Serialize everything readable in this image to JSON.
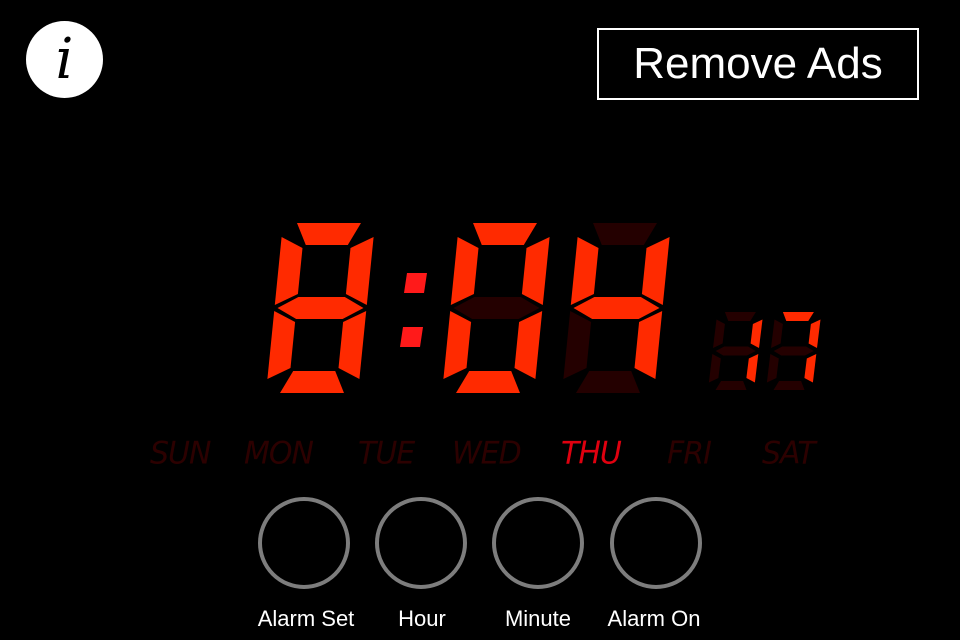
{
  "header": {
    "info_icon_glyph": "i",
    "remove_ads_label": "Remove Ads"
  },
  "clock": {
    "hour": "8",
    "minute": "04",
    "seconds": "17",
    "colon": ":",
    "colors": {
      "segment_on": "#ff2a00",
      "segment_off": "#240000",
      "colon": "#ff1a1a"
    }
  },
  "days": {
    "items": [
      "SUN",
      "MON",
      "TUE",
      "WED",
      "THU",
      "FRI",
      "SAT"
    ],
    "active": "THU",
    "colors": {
      "active": "#e0000f",
      "inactive": "#2c0000"
    }
  },
  "controls": [
    {
      "label": "Alarm Set"
    },
    {
      "label": "Hour"
    },
    {
      "label": "Minute"
    },
    {
      "label": "Alarm On"
    }
  ]
}
